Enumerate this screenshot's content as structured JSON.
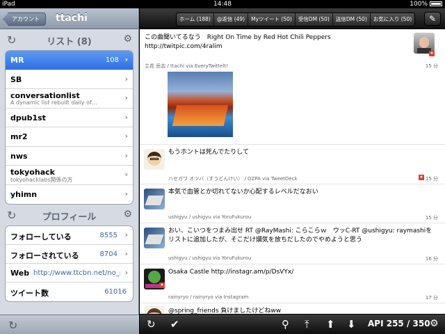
{
  "status": {
    "device": "iPad",
    "time": "14:48",
    "battery": "100%"
  },
  "sidebar": {
    "back_label": "アカウント",
    "title": "ttachi",
    "lists_title": "リスト (8)",
    "lists": [
      {
        "name": "MR",
        "count": "108",
        "sub": ""
      },
      {
        "name": "SB",
        "count": "",
        "sub": ""
      },
      {
        "name": "conversationlist",
        "count": "",
        "sub": "A dynamic list rebuilt daily of…"
      },
      {
        "name": "dpub1st",
        "count": "",
        "sub": ""
      },
      {
        "name": "mr2",
        "count": "",
        "sub": ""
      },
      {
        "name": "nws",
        "count": "",
        "sub": ""
      },
      {
        "name": "tokyohack",
        "count": "",
        "sub": "tokyohacklabs関係の方"
      },
      {
        "name": "yhimn",
        "count": "",
        "sub": ""
      }
    ],
    "profile_title": "プロフィール",
    "profile": [
      {
        "label": "フォローしている",
        "value": "8555"
      },
      {
        "label": "フォローされている",
        "value": "8704"
      },
      {
        "label": "Web",
        "value": "http://www.ttcbn.net/no_s…"
      },
      {
        "label": "ツイート数",
        "value": "61016"
      }
    ]
  },
  "tabs": [
    "ホーム (188)",
    "@返信 (49)",
    "Myツイート (50)",
    "受信DM (50)",
    "送信DM (50)",
    "お気に入り (50)"
  ],
  "tweets": [
    {
      "text": "この曲聞いてるなう　Right On Time by Red Hot Chili Peppers http://twitpic.com/4ralim",
      "meta": "立花 岳志 / ttachi via EveryTwittelt!",
      "time": "15 分"
    },
    {
      "text": "もうホントは死んでたりして",
      "meta": "ハセガワ オツバ（すうどんけい） / OZPA via TweetDeck",
      "time": "15 分"
    },
    {
      "text": "本気で血管とか切れてないか心配するレベルだなおい",
      "meta": "ushigyu / ushigyu via YoruFukurou",
      "time": "15 分"
    },
    {
      "text": "おい、こいつをつまみ出せ RT @RayMashi: こらこらｗ　ウッC-RT @ushigyu: raymashiをリストに追加したが、そこだけ爛気を放ちだしたのでやめようと思う",
      "meta": "ushigyu / ushigyu via YoruFukurou",
      "time": "16 分"
    },
    {
      "text": "Osaka Castle http://instagr.am/p/DsVYx/",
      "meta": "rainyryo / rainyryo via Instagram",
      "time": "17 分"
    },
    {
      "text": "@spring_friends 負けましたけどねww",
      "meta": "",
      "time": ""
    }
  ],
  "api_label": "API 255 / 350",
  "colors": {
    "selected": "#2f6fe0",
    "link": "#3a65a8",
    "fav": "#e63b2e"
  }
}
